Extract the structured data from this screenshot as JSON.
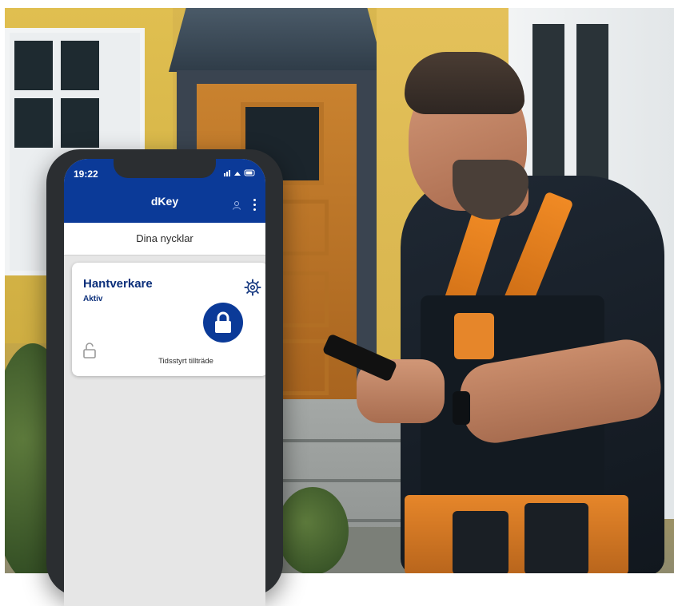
{
  "status_bar": {
    "time": "19:22",
    "icons": "signal wifi battery"
  },
  "app": {
    "title": "dKey",
    "account_icon": "account-icon",
    "menu_icon": "more-vertical-icon"
  },
  "keys_section": {
    "title": "Dina nycklar"
  },
  "key_card": {
    "name": "Hantverkare",
    "status": "Aktiv",
    "footer": "Tidsstyrt tillträde",
    "settings_icon": "gear-icon",
    "unlock_icon": "padlock-icon",
    "history_icon": "open-lock-icon"
  },
  "colors": {
    "brand_blue": "#0b3a98",
    "card_title": "#0b2f7a",
    "screen_bg": "#e6e6e6"
  }
}
